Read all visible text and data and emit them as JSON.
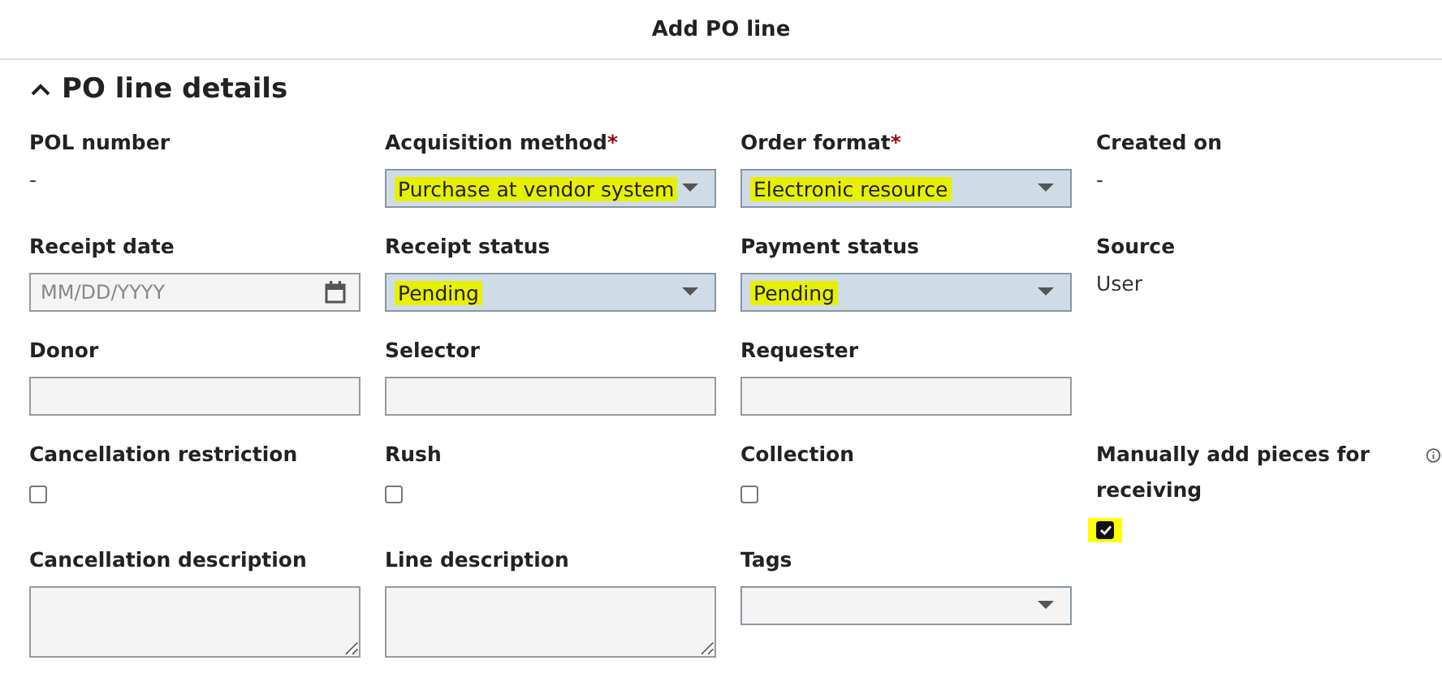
{
  "header": {
    "title": "Add PO line"
  },
  "section": {
    "title": "PO line details",
    "expanded": true
  },
  "rows": [
    [
      {
        "kind": "text",
        "label": "POL number",
        "value": "-"
      },
      {
        "kind": "select",
        "label": "Acquisition method",
        "required_mark": "*",
        "value": "Purchase at vendor system",
        "highlighted": true
      },
      {
        "kind": "select",
        "label": "Order format",
        "required_mark": "*",
        "value": "Electronic resource",
        "highlighted": true
      },
      {
        "kind": "text",
        "label": "Created on",
        "value": "-"
      }
    ],
    [
      {
        "kind": "date",
        "label": "Receipt date",
        "placeholder": "MM/DD/YYYY"
      },
      {
        "kind": "select",
        "label": "Receipt status",
        "value": "Pending",
        "highlighted": true
      },
      {
        "kind": "select",
        "label": "Payment status",
        "value": "Pending",
        "highlighted": true
      },
      {
        "kind": "text",
        "label": "Source",
        "value": "User"
      }
    ],
    [
      {
        "kind": "input",
        "label": "Donor"
      },
      {
        "kind": "input",
        "label": "Selector"
      },
      {
        "kind": "input",
        "label": "Requester"
      }
    ],
    [
      {
        "kind": "checkbox",
        "label": "Cancellation restriction",
        "checked": false,
        "highlighted": false
      },
      {
        "kind": "checkbox",
        "label": "Rush",
        "checked": false,
        "highlighted": false
      },
      {
        "kind": "checkbox",
        "label": "Collection",
        "checked": false,
        "highlighted": false
      },
      {
        "kind": "checkbox",
        "label": "Manually add pieces for receiving",
        "checked": true,
        "highlighted": true,
        "info": true
      }
    ],
    [
      {
        "kind": "textarea",
        "label": "Cancellation description"
      },
      {
        "kind": "textarea",
        "label": "Line description"
      },
      {
        "kind": "select",
        "label": "Tags",
        "plain": true
      }
    ]
  ]
}
